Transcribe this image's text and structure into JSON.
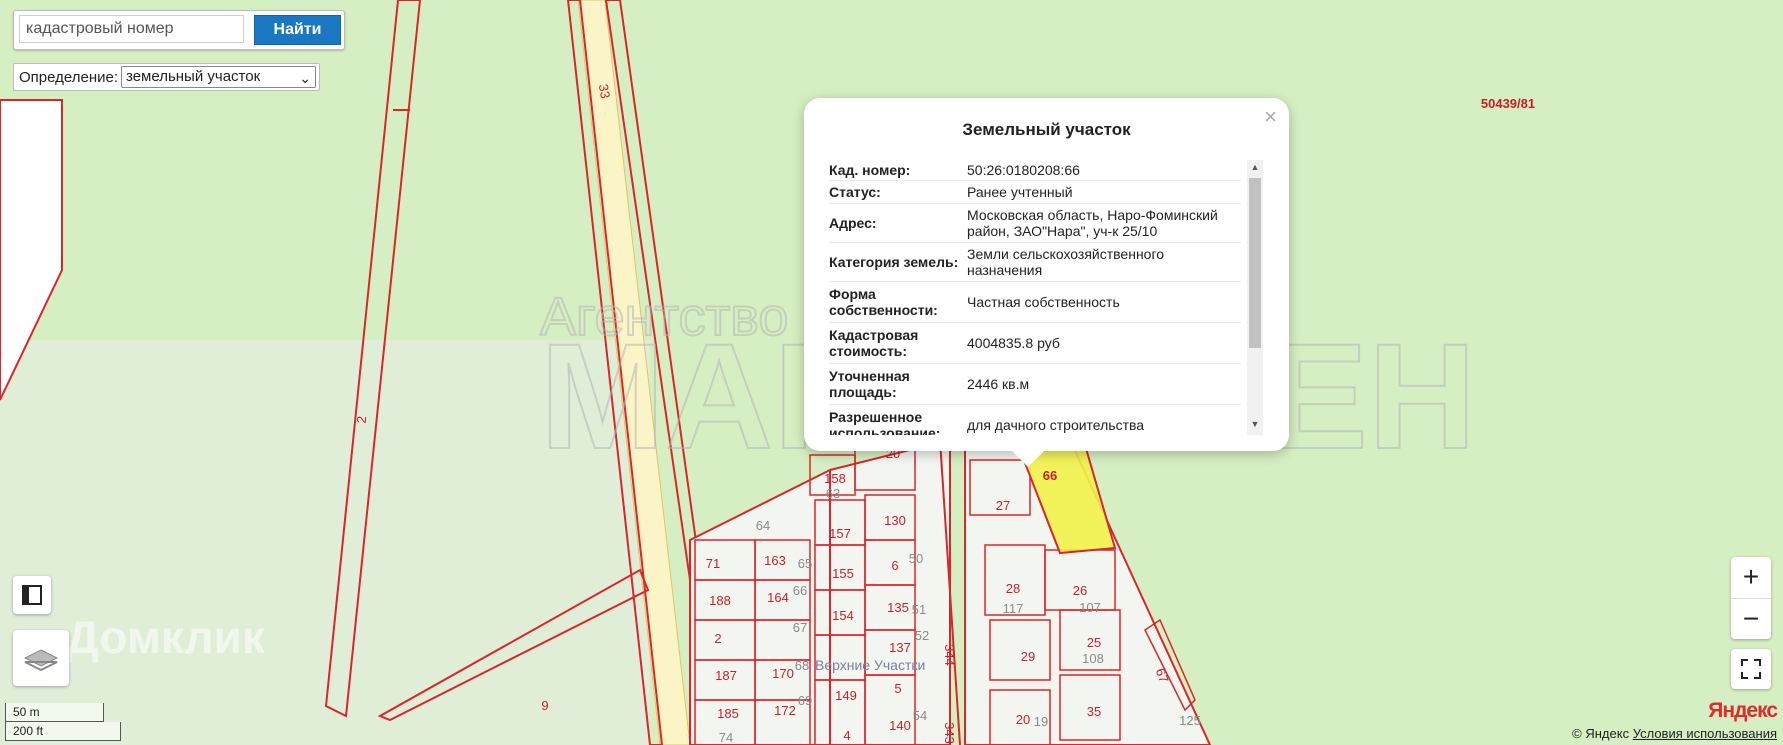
{
  "search": {
    "placeholder": "кадастровый номер",
    "button_label": "Найти"
  },
  "definition": {
    "label": "Определение:",
    "selected": "земельный участок"
  },
  "popup": {
    "title": "Земельный участок",
    "close": "×",
    "rows": [
      {
        "key": "Кад. номер",
        "value": "50:26:0180208:66"
      },
      {
        "key": "Статус",
        "value": "Ранее учтенный"
      },
      {
        "key": "Адрес",
        "value": "Московская область, Наро-Фоминский район, ЗАО\"Нара\", уч-к 25/10"
      },
      {
        "key": "Категория земель",
        "value": "Земли сельскохозяйственного назначения"
      },
      {
        "key": "Форма собственности",
        "value": "Частная собственность"
      },
      {
        "key": "Кадастровая стоимость",
        "value": "4004835.8 руб"
      },
      {
        "key": "Уточненная площадь",
        "value": "2446 кв.м"
      },
      {
        "key": "Разрешенное использование",
        "value": "для дачного строительства"
      }
    ]
  },
  "map_labels": {
    "parcel_ref": "50439/81",
    "road_33": "33",
    "road_2": "2",
    "selected_parcel": "66",
    "parcels": [
      "158",
      "20",
      "63",
      "64",
      "130",
      "157",
      "71",
      "163",
      "65",
      "6",
      "50",
      "155",
      "188",
      "164",
      "66",
      "135",
      "51",
      "154",
      "2",
      "67",
      "52",
      "137",
      "187",
      "170",
      "68",
      "5",
      "149",
      "185",
      "172",
      "69",
      "140",
      "54",
      "74",
      "4",
      "27",
      "28",
      "117",
      "26",
      "107",
      "29",
      "25",
      "108",
      "20",
      "19",
      "35",
      "67",
      "125",
      "9",
      "344",
      "343"
    ],
    "place": "Верхние Участки"
  },
  "watermarks": {
    "agency": "Агентство недвижимости",
    "brand": "МАНХЭТТЕН",
    "domclick": "Домклик"
  },
  "controls": {
    "zoom_in": "+",
    "zoom_out": "−"
  },
  "scale": {
    "metric": "50 m",
    "imperial": "200 ft"
  },
  "attribution": {
    "logo": "Яндекс",
    "copyright": "© Яндекс",
    "terms": "Условия использования"
  },
  "colors": {
    "map_green": "#d6efc2",
    "parcel_line": "#d9262b",
    "selected_fill": "#f2f24a",
    "button_blue": "#1a78c2"
  }
}
